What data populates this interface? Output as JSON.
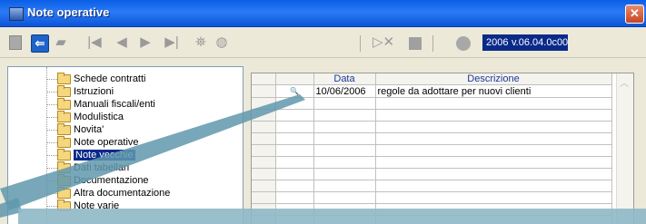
{
  "window": {
    "title": "Note operative",
    "close_glyph": "✕"
  },
  "toolbar": {
    "icons": [
      "save-icon",
      "back-arrow-icon",
      "document-icon",
      "first-record-icon",
      "previous-record-icon",
      "next-record-icon",
      "last-record-icon",
      "binoculars-icon",
      "zoom-icon",
      "export-icon",
      "stop-icon",
      "record-circle-icon"
    ],
    "first": "|◀",
    "prev": "◀",
    "next": "▶",
    "last": "▶|",
    "find": "⛯",
    "zoom": "🔍",
    "exp": "▶✕",
    "version_year": "2006",
    "version_code": "v.06.04.0c00"
  },
  "tree": {
    "items": [
      {
        "label": "Schede contratti",
        "selected": false
      },
      {
        "label": "Istruzioni",
        "selected": false
      },
      {
        "label": "Manuali fiscali/enti",
        "selected": false
      },
      {
        "label": "Modulistica",
        "selected": false
      },
      {
        "label": "Novita'",
        "selected": false
      },
      {
        "label": "Note operative",
        "selected": false
      },
      {
        "label": "Note vecchie",
        "selected": true
      },
      {
        "label": "Dati tabellari",
        "selected": false
      },
      {
        "label": "Documentazione",
        "selected": false
      },
      {
        "label": "Altra documentazione",
        "selected": false
      },
      {
        "label": "Note varie",
        "selected": false
      }
    ]
  },
  "grid": {
    "headers": {
      "data": "Data",
      "descrizione": "Descrizione"
    },
    "rows": [
      {
        "icon": "search-icon",
        "data": "10/06/2006",
        "descrizione": "regole da adottare per nuovi clienti"
      }
    ]
  },
  "colors": {
    "title_bar": "#0a5fe6",
    "selection": "#0a2a8a",
    "header_text": "#1a3a9a",
    "folder": "#f4d77e",
    "overlay_callout": "#7aa6b8"
  }
}
